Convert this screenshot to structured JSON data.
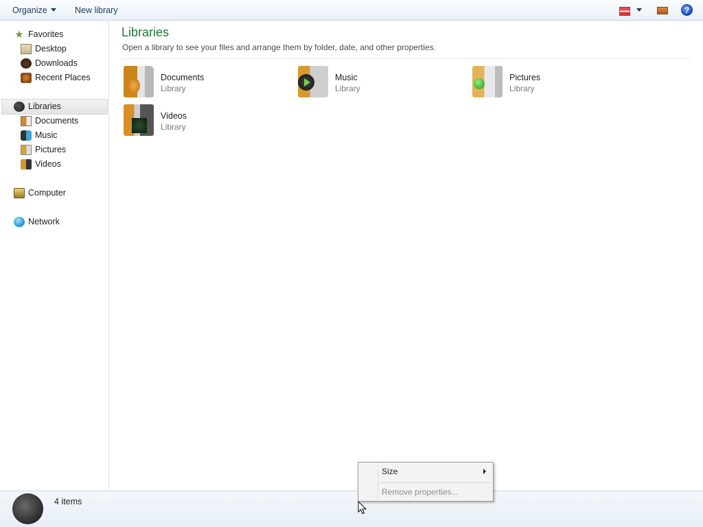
{
  "toolbar": {
    "organize_label": "Organize",
    "new_library_label": "New library",
    "help_label": "?"
  },
  "sidebar": {
    "favorites": {
      "label": "Favorites",
      "items": [
        {
          "label": "Desktop"
        },
        {
          "label": "Downloads"
        },
        {
          "label": "Recent Places"
        }
      ]
    },
    "libraries": {
      "label": "Libraries",
      "items": [
        {
          "label": "Documents"
        },
        {
          "label": "Music"
        },
        {
          "label": "Pictures"
        },
        {
          "label": "Videos"
        }
      ]
    },
    "computer": {
      "label": "Computer"
    },
    "network": {
      "label": "Network"
    }
  },
  "main": {
    "title": "Libraries",
    "subtitle": "Open a library to see your files and arrange them by folder, date, and other properties.",
    "libraries": [
      {
        "name": "Documents",
        "type": "Library",
        "icon": "documents-library-icon"
      },
      {
        "name": "Music",
        "type": "Library",
        "icon": "music-library-icon"
      },
      {
        "name": "Pictures",
        "type": "Library",
        "icon": "pictures-library-icon"
      },
      {
        "name": "Videos",
        "type": "Library",
        "icon": "videos-library-icon"
      }
    ]
  },
  "status": {
    "count": "4 items"
  },
  "context_menu": {
    "items": [
      {
        "label": "Size",
        "has_submenu": true,
        "enabled": true
      },
      {
        "label": "Remove properties...",
        "has_submenu": false,
        "enabled": false
      }
    ]
  },
  "colors": {
    "title_green": "#1e7a2e",
    "toolbar_bg": "#e9f0f8",
    "disabled_text": "#8d8d8d"
  }
}
